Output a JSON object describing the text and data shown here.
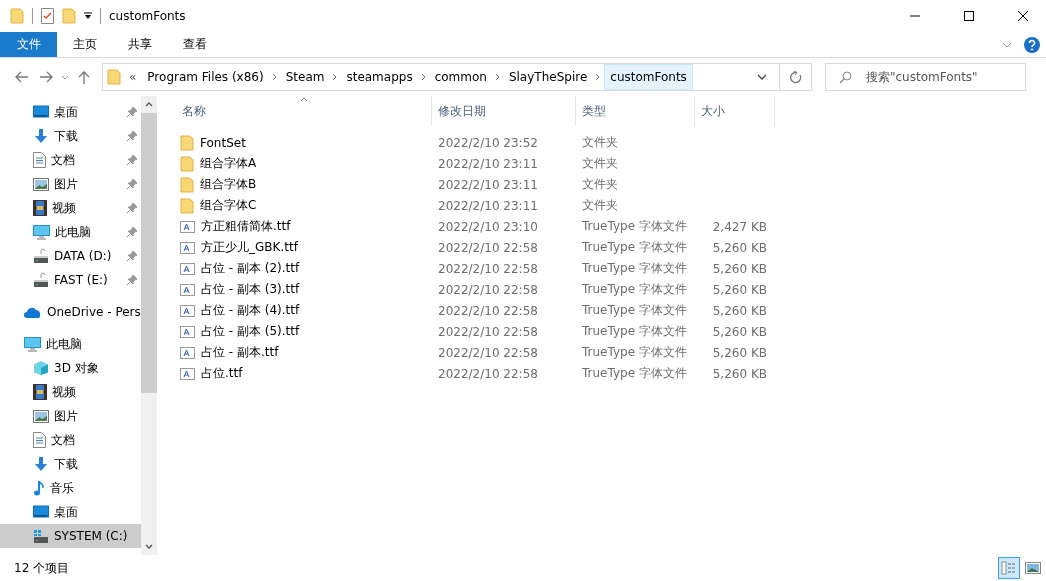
{
  "window": {
    "title": "customFonts"
  },
  "ribbon": {
    "tabs": [
      {
        "label": "文件",
        "selected": true
      },
      {
        "label": "主页",
        "selected": false
      },
      {
        "label": "共享",
        "selected": false
      },
      {
        "label": "查看",
        "selected": false
      }
    ]
  },
  "address": {
    "overflow": "«",
    "crumbs": [
      {
        "label": "Program Files (x86)",
        "selected": false
      },
      {
        "label": "Steam",
        "selected": false
      },
      {
        "label": "steamapps",
        "selected": false
      },
      {
        "label": "common",
        "selected": false
      },
      {
        "label": "SlayTheSpire",
        "selected": false
      },
      {
        "label": "customFonts",
        "selected": true
      }
    ]
  },
  "search": {
    "placeholder": "搜索\"customFonts\""
  },
  "sidebar": {
    "items": [
      {
        "label": "桌面",
        "kind": "desktop",
        "pinned": true,
        "selected": false
      },
      {
        "label": "下载",
        "kind": "download",
        "pinned": true,
        "selected": false
      },
      {
        "label": "文档",
        "kind": "document",
        "pinned": true,
        "selected": false
      },
      {
        "label": "图片",
        "kind": "picture",
        "pinned": true,
        "selected": false
      },
      {
        "label": "视频",
        "kind": "video",
        "pinned": true,
        "selected": false
      },
      {
        "label": "此电脑",
        "kind": "pc",
        "pinned": true,
        "selected": false
      },
      {
        "label": "DATA (D:)",
        "kind": "drive",
        "pinned": true,
        "selected": false
      },
      {
        "label": "FAST (E:)",
        "kind": "drive",
        "pinned": true,
        "selected": false
      }
    ],
    "roots": [
      {
        "label": "OneDrive - Pers",
        "kind": "cloud",
        "selected": false
      },
      {
        "label": "此电脑",
        "kind": "pc",
        "selected": false,
        "children": [
          {
            "label": "3D 对象",
            "kind": "cube",
            "selected": false
          },
          {
            "label": "视频",
            "kind": "video",
            "selected": false
          },
          {
            "label": "图片",
            "kind": "picture",
            "selected": false
          },
          {
            "label": "文档",
            "kind": "document",
            "selected": false
          },
          {
            "label": "下载",
            "kind": "download",
            "selected": false
          },
          {
            "label": "音乐",
            "kind": "music",
            "selected": false
          },
          {
            "label": "桌面",
            "kind": "desktop",
            "selected": false
          },
          {
            "label": "SYSTEM (C:)",
            "kind": "system",
            "selected": true
          }
        ]
      }
    ]
  },
  "table": {
    "columns": [
      {
        "label": "名称",
        "sorted": true
      },
      {
        "label": "修改日期",
        "sorted": false
      },
      {
        "label": "类型",
        "sorted": false
      },
      {
        "label": "大小",
        "sorted": false
      }
    ],
    "rows": [
      {
        "kind": "folder",
        "name": "FontSet",
        "date": "2022/2/10 23:52",
        "type": "文件夹"
      },
      {
        "kind": "folder",
        "name": "组合字体A",
        "date": "2022/2/10 23:11",
        "type": "文件夹"
      },
      {
        "kind": "folder",
        "name": "组合字体B",
        "date": "2022/2/10 23:11",
        "type": "文件夹"
      },
      {
        "kind": "folder",
        "name": "组合字体C",
        "date": "2022/2/10 23:11",
        "type": "文件夹"
      },
      {
        "kind": "font",
        "name": "方正粗倩简体.ttf",
        "date": "2022/2/10 23:10",
        "type": "TrueType 字体文件",
        "size": "2,427 KB"
      },
      {
        "kind": "font",
        "name": "方正少儿_GBK.ttf",
        "date": "2022/2/10 22:58",
        "type": "TrueType 字体文件",
        "size": "5,260 KB"
      },
      {
        "kind": "font",
        "name": "占位 - 副本 (2).ttf",
        "date": "2022/2/10 22:58",
        "type": "TrueType 字体文件",
        "size": "5,260 KB"
      },
      {
        "kind": "font",
        "name": "占位 - 副本 (3).ttf",
        "date": "2022/2/10 22:58",
        "type": "TrueType 字体文件",
        "size": "5,260 KB"
      },
      {
        "kind": "font",
        "name": "占位 - 副本 (4).ttf",
        "date": "2022/2/10 22:58",
        "type": "TrueType 字体文件",
        "size": "5,260 KB"
      },
      {
        "kind": "font",
        "name": "占位 - 副本 (5).ttf",
        "date": "2022/2/10 22:58",
        "type": "TrueType 字体文件",
        "size": "5,260 KB"
      },
      {
        "kind": "font",
        "name": "占位 - 副本.ttf",
        "date": "2022/2/10 22:58",
        "type": "TrueType 字体文件",
        "size": "5,260 KB"
      },
      {
        "kind": "font",
        "name": "占位.ttf",
        "date": "2022/2/10 22:58",
        "type": "TrueType 字体文件",
        "size": "5,260 KB"
      }
    ]
  },
  "status_bar": {
    "count": "12 个项目",
    "views": [
      {
        "kind": "details",
        "selected": true
      },
      {
        "kind": "large_icons",
        "selected": false
      }
    ]
  }
}
